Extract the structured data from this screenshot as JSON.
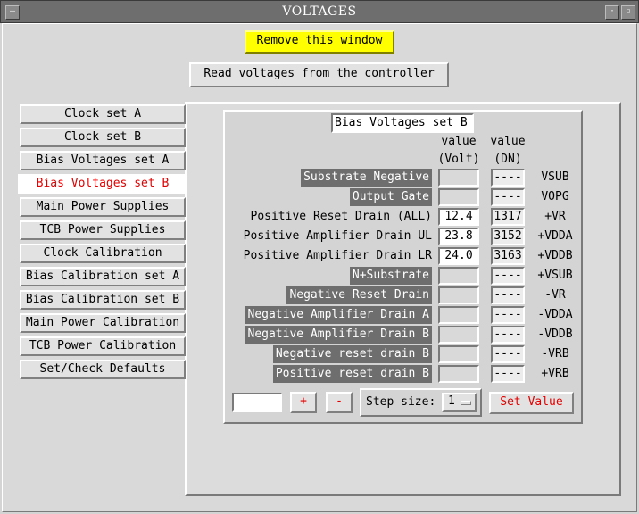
{
  "window": {
    "title": "VOLTAGES"
  },
  "top_buttons": {
    "remove": "Remove this window",
    "read": "Read voltages from the controller"
  },
  "sidebar": {
    "items": [
      {
        "label": "Clock set A"
      },
      {
        "label": "Clock set B"
      },
      {
        "label": "Bias Voltages set A"
      },
      {
        "label": "Bias Voltages set B"
      },
      {
        "label": "Main Power Supplies"
      },
      {
        "label": "TCB Power Supplies"
      },
      {
        "label": "Clock Calibration"
      },
      {
        "label": "Bias Calibration set A"
      },
      {
        "label": "Bias Calibration set B"
      },
      {
        "label": "Main Power Calibration"
      },
      {
        "label": "TCB Power Calibration"
      },
      {
        "label": "Set/Check Defaults"
      }
    ],
    "active_index": 3
  },
  "group": {
    "title": "Bias Voltages set B",
    "col_value_volt": [
      "value",
      "(Volt)"
    ],
    "col_value_dn": [
      "value",
      "(DN)"
    ]
  },
  "rows": [
    {
      "label": "Substrate Negative",
      "dark": true,
      "volt": "",
      "dn": "----",
      "code": "VSUB"
    },
    {
      "label": "Output Gate",
      "dark": true,
      "volt": "",
      "dn": "----",
      "code": "VOPG"
    },
    {
      "label": "Positive Reset Drain (ALL)",
      "dark": false,
      "volt": "12.4",
      "dn": "1317",
      "code": "+VR"
    },
    {
      "label": "Positive Amplifier Drain UL",
      "dark": false,
      "volt": "23.8",
      "dn": "3152",
      "code": "+VDDA"
    },
    {
      "label": "Positive Amplifier Drain LR",
      "dark": false,
      "volt": "24.0",
      "dn": "3163",
      "code": "+VDDB"
    },
    {
      "label": "N+Substrate",
      "dark": true,
      "volt": "",
      "dn": "----",
      "code": "+VSUB"
    },
    {
      "label": "Negative Reset Drain",
      "dark": true,
      "volt": "",
      "dn": "----",
      "code": "-VR"
    },
    {
      "label": "Negative Amplifier Drain A",
      "dark": true,
      "volt": "",
      "dn": "----",
      "code": "-VDDA"
    },
    {
      "label": "Negative Amplifier Drain B",
      "dark": true,
      "volt": "",
      "dn": "----",
      "code": "-VDDB"
    },
    {
      "label": "Negative reset drain B",
      "dark": true,
      "volt": "",
      "dn": "----",
      "code": "-VRB"
    },
    {
      "label": "Positive reset drain B",
      "dark": true,
      "volt": "",
      "dn": "----",
      "code": "+VRB"
    }
  ],
  "controls": {
    "value_input": "",
    "plus": "+",
    "minus": "-",
    "step_label": "Step size:",
    "step_value": "1",
    "set_value": "Set Value"
  },
  "colors": {
    "accent_red": "#e00000",
    "highlight_yellow": "#ffff00",
    "dark_label": "#6e6e6e"
  }
}
